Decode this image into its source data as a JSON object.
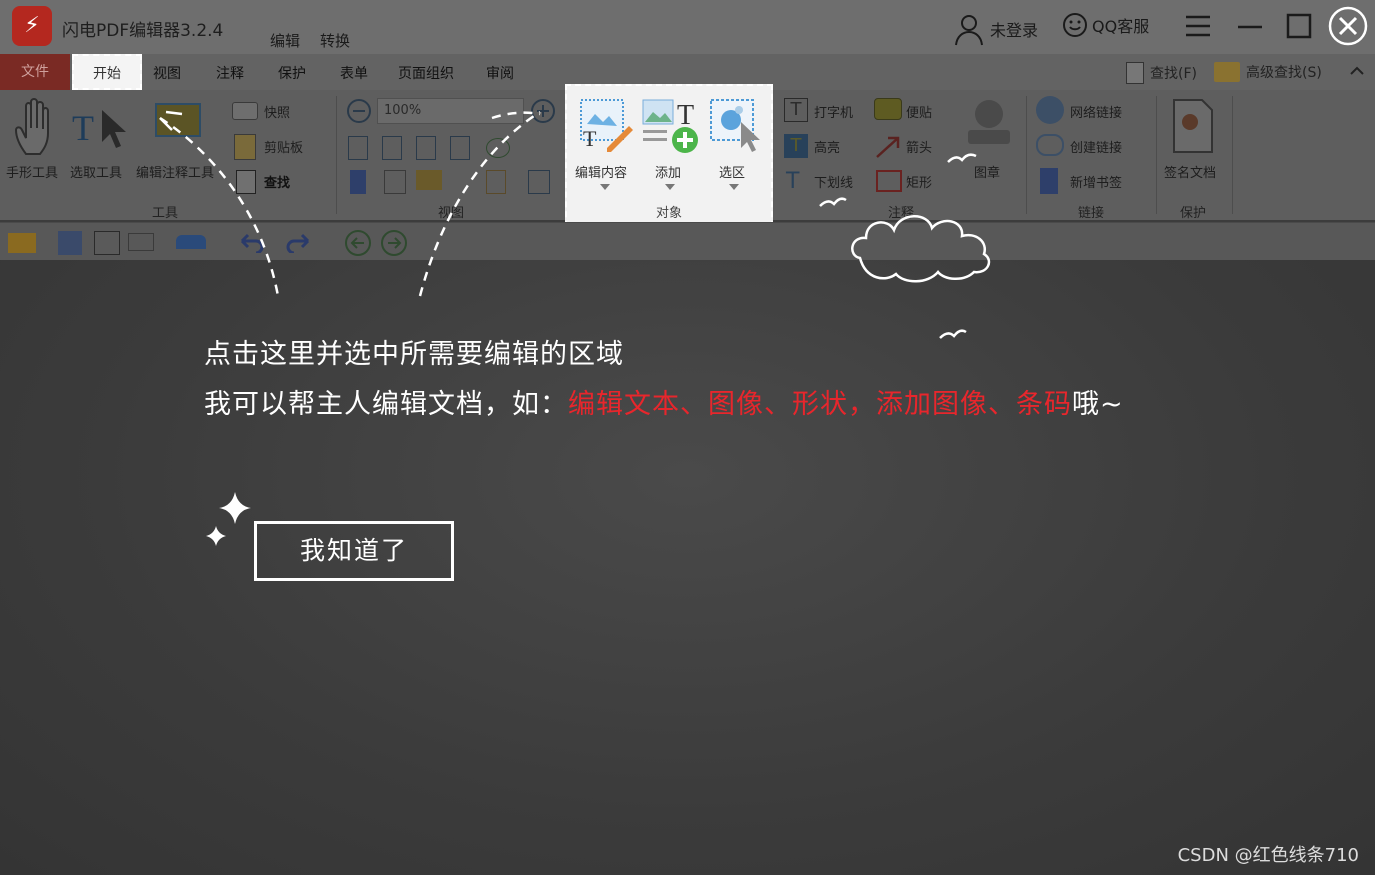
{
  "app": {
    "title": "闪电PDF编辑器3.2.4",
    "top_tabs": [
      "编辑",
      "转换"
    ],
    "login_label": "未登录",
    "service_label": "QQ客服"
  },
  "menu": {
    "items": [
      "文件",
      "开始",
      "视图",
      "注释",
      "保护",
      "表单",
      "页面组织",
      "审阅"
    ],
    "find_label": "查找(F)",
    "advanced_find_label": "高级查找(S)"
  },
  "ribbon": {
    "tools": {
      "hand": "手形工具",
      "select": "选取工具",
      "annot_edit": "编辑注释工具",
      "snapshot": "快照",
      "clipboard": "剪贴板",
      "find": "查找",
      "group": "工具"
    },
    "view": {
      "zoom": "100%",
      "group": "视图"
    },
    "object": {
      "edit_content": "编辑内容",
      "add": "添加",
      "select_area": "选区",
      "group": "对象"
    },
    "comment": {
      "typewriter": "打字机",
      "note": "便贴",
      "highlight": "高亮",
      "arrow": "箭头",
      "underline": "下划线",
      "rect": "矩形",
      "stamp": "图章",
      "group": "注释"
    },
    "link": {
      "web_link": "网络链接",
      "create_link": "创建链接",
      "add_bookmark": "新增书签",
      "group": "链接"
    },
    "protect": {
      "sign": "签名文档",
      "group": "保护"
    }
  },
  "guide": {
    "line1": "点击这里并选中所需要编辑的区域",
    "line2_prefix": "我可以帮主人编辑文档，如：",
    "line2_highlight": "编辑文本、图像、形状，添加图像、条码",
    "line2_suffix": "哦~",
    "button": "我知道了"
  },
  "watermark": "CSDN @红色线条710",
  "colors": {
    "accent_red": "#e8262c",
    "logo_red": "#b4281f",
    "overlay_bg": "#3c3c3c"
  }
}
